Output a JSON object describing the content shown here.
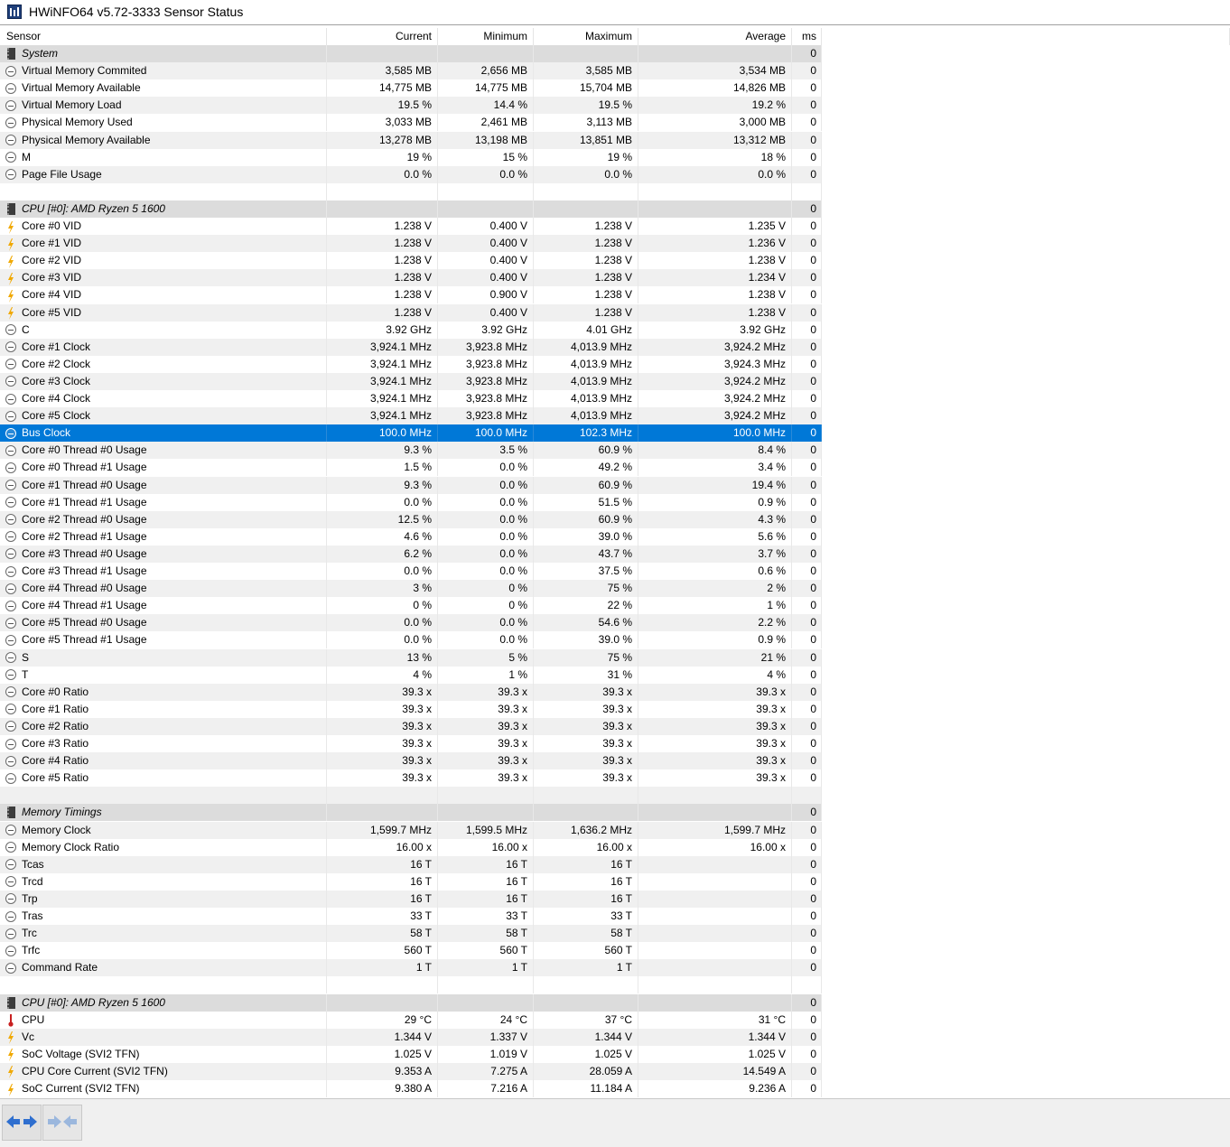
{
  "window": {
    "title": "HWiNFO64 v5.72-3333 Sensor Status"
  },
  "columns": {
    "sensor": "Sensor",
    "current": "Current",
    "minimum": "Minimum",
    "maximum": "Maximum",
    "average": "Average",
    "ms": "ms"
  },
  "rows": [
    {
      "type": "group",
      "icon": "chip-icon",
      "name": "System",
      "ms": "0"
    },
    {
      "type": "item",
      "icon": "gauge-icon",
      "name": "Virtual Memory Commited",
      "cur": "3,585 MB",
      "min": "2,656 MB",
      "max": "3,585 MB",
      "avg": "3,534 MB",
      "ms": "0"
    },
    {
      "type": "item",
      "icon": "gauge-icon",
      "name": "Virtual Memory Available",
      "cur": "14,775 MB",
      "min": "14,775 MB",
      "max": "15,704 MB",
      "avg": "14,826 MB",
      "ms": "0"
    },
    {
      "type": "item",
      "icon": "gauge-icon",
      "name": "Virtual Memory Load",
      "cur": "19.5 %",
      "min": "14.4 %",
      "max": "19.5 %",
      "avg": "19.2 %",
      "ms": "0"
    },
    {
      "type": "item",
      "icon": "gauge-icon",
      "name": "Physical Memory Used",
      "cur": "3,033 MB",
      "min": "2,461 MB",
      "max": "3,113 MB",
      "avg": "3,000 MB",
      "ms": "0"
    },
    {
      "type": "item",
      "icon": "gauge-icon",
      "name": "Physical Memory Available",
      "cur": "13,278 MB",
      "min": "13,198 MB",
      "max": "13,851 MB",
      "avg": "13,312 MB",
      "ms": "0"
    },
    {
      "type": "item",
      "icon": "gauge-icon",
      "name": "M",
      "cur": "19 %",
      "min": "15 %",
      "max": "19 %",
      "avg": "18 %",
      "ms": "0"
    },
    {
      "type": "item",
      "icon": "gauge-icon",
      "name": "Page File Usage",
      "cur": "0.0 %",
      "min": "0.0 %",
      "max": "0.0 %",
      "avg": "0.0 %",
      "ms": "0"
    },
    {
      "type": "blank"
    },
    {
      "type": "group",
      "icon": "chip-icon",
      "name": "CPU [#0]: AMD Ryzen 5 1600",
      "ms": "0"
    },
    {
      "type": "item",
      "icon": "voltage-icon",
      "name": "Core #0 VID",
      "cur": "1.238 V",
      "min": "0.400 V",
      "max": "1.238 V",
      "avg": "1.235 V",
      "ms": "0"
    },
    {
      "type": "item",
      "icon": "voltage-icon",
      "name": "Core #1 VID",
      "cur": "1.238 V",
      "min": "0.400 V",
      "max": "1.238 V",
      "avg": "1.236 V",
      "ms": "0"
    },
    {
      "type": "item",
      "icon": "voltage-icon",
      "name": "Core #2 VID",
      "cur": "1.238 V",
      "min": "0.400 V",
      "max": "1.238 V",
      "avg": "1.238 V",
      "ms": "0"
    },
    {
      "type": "item",
      "icon": "voltage-icon",
      "name": "Core #3 VID",
      "cur": "1.238 V",
      "min": "0.400 V",
      "max": "1.238 V",
      "avg": "1.234 V",
      "ms": "0"
    },
    {
      "type": "item",
      "icon": "voltage-icon",
      "name": "Core #4 VID",
      "cur": "1.238 V",
      "min": "0.900 V",
      "max": "1.238 V",
      "avg": "1.238 V",
      "ms": "0"
    },
    {
      "type": "item",
      "icon": "voltage-icon",
      "name": "Core #5 VID",
      "cur": "1.238 V",
      "min": "0.400 V",
      "max": "1.238 V",
      "avg": "1.238 V",
      "ms": "0"
    },
    {
      "type": "item",
      "icon": "gauge-icon",
      "name": "C",
      "cur": "3.92 GHz",
      "min": "3.92 GHz",
      "max": "4.01 GHz",
      "avg": "3.92 GHz",
      "ms": "0"
    },
    {
      "type": "item",
      "icon": "gauge-icon",
      "name": "Core #1 Clock",
      "cur": "3,924.1 MHz",
      "min": "3,923.8 MHz",
      "max": "4,013.9 MHz",
      "avg": "3,924.2 MHz",
      "ms": "0"
    },
    {
      "type": "item",
      "icon": "gauge-icon",
      "name": "Core #2 Clock",
      "cur": "3,924.1 MHz",
      "min": "3,923.8 MHz",
      "max": "4,013.9 MHz",
      "avg": "3,924.3 MHz",
      "ms": "0"
    },
    {
      "type": "item",
      "icon": "gauge-icon",
      "name": "Core #3 Clock",
      "cur": "3,924.1 MHz",
      "min": "3,923.8 MHz",
      "max": "4,013.9 MHz",
      "avg": "3,924.2 MHz",
      "ms": "0"
    },
    {
      "type": "item",
      "icon": "gauge-icon",
      "name": "Core #4 Clock",
      "cur": "3,924.1 MHz",
      "min": "3,923.8 MHz",
      "max": "4,013.9 MHz",
      "avg": "3,924.2 MHz",
      "ms": "0"
    },
    {
      "type": "item",
      "icon": "gauge-icon",
      "name": "Core #5 Clock",
      "cur": "3,924.1 MHz",
      "min": "3,923.8 MHz",
      "max": "4,013.9 MHz",
      "avg": "3,924.2 MHz",
      "ms": "0"
    },
    {
      "type": "item",
      "icon": "gauge-icon",
      "name": "Bus Clock",
      "cur": "100.0 MHz",
      "min": "100.0 MHz",
      "max": "102.3 MHz",
      "avg": "100.0 MHz",
      "ms": "0",
      "selected": true
    },
    {
      "type": "item",
      "icon": "gauge-icon",
      "name": "Core #0 Thread #0 Usage",
      "cur": "9.3 %",
      "min": "3.5 %",
      "max": "60.9 %",
      "avg": "8.4 %",
      "ms": "0"
    },
    {
      "type": "item",
      "icon": "gauge-icon",
      "name": "Core #0 Thread #1 Usage",
      "cur": "1.5 %",
      "min": "0.0 %",
      "max": "49.2 %",
      "avg": "3.4 %",
      "ms": "0"
    },
    {
      "type": "item",
      "icon": "gauge-icon",
      "name": "Core #1 Thread #0 Usage",
      "cur": "9.3 %",
      "min": "0.0 %",
      "max": "60.9 %",
      "avg": "19.4 %",
      "ms": "0"
    },
    {
      "type": "item",
      "icon": "gauge-icon",
      "name": "Core #1 Thread #1 Usage",
      "cur": "0.0 %",
      "min": "0.0 %",
      "max": "51.5 %",
      "avg": "0.9 %",
      "ms": "0"
    },
    {
      "type": "item",
      "icon": "gauge-icon",
      "name": "Core #2 Thread #0 Usage",
      "cur": "12.5 %",
      "min": "0.0 %",
      "max": "60.9 %",
      "avg": "4.3 %",
      "ms": "0"
    },
    {
      "type": "item",
      "icon": "gauge-icon",
      "name": "Core #2 Thread #1 Usage",
      "cur": "4.6 %",
      "min": "0.0 %",
      "max": "39.0 %",
      "avg": "5.6 %",
      "ms": "0"
    },
    {
      "type": "item",
      "icon": "gauge-icon",
      "name": "Core #3 Thread #0 Usage",
      "cur": "6.2 %",
      "min": "0.0 %",
      "max": "43.7 %",
      "avg": "3.7 %",
      "ms": "0"
    },
    {
      "type": "item",
      "icon": "gauge-icon",
      "name": "Core #3 Thread #1 Usage",
      "cur": "0.0 %",
      "min": "0.0 %",
      "max": "37.5 %",
      "avg": "0.6 %",
      "ms": "0"
    },
    {
      "type": "item",
      "icon": "gauge-icon",
      "name": "Core #4 Thread #0 Usage",
      "cur": "3 %",
      "min": "0 %",
      "max": "75 %",
      "avg": "2 %",
      "ms": "0"
    },
    {
      "type": "item",
      "icon": "gauge-icon",
      "name": "Core #4 Thread #1 Usage",
      "cur": "0 %",
      "min": "0 %",
      "max": "22 %",
      "avg": "1 %",
      "ms": "0"
    },
    {
      "type": "item",
      "icon": "gauge-icon",
      "name": "Core #5 Thread #0 Usage",
      "cur": "0.0 %",
      "min": "0.0 %",
      "max": "54.6 %",
      "avg": "2.2 %",
      "ms": "0"
    },
    {
      "type": "item",
      "icon": "gauge-icon",
      "name": "Core #5 Thread #1 Usage",
      "cur": "0.0 %",
      "min": "0.0 %",
      "max": "39.0 %",
      "avg": "0.9 %",
      "ms": "0"
    },
    {
      "type": "item",
      "icon": "gauge-icon",
      "name": "S",
      "cur": "13 %",
      "min": "5 %",
      "max": "75 %",
      "avg": "21 %",
      "ms": "0"
    },
    {
      "type": "item",
      "icon": "gauge-icon",
      "name": "T",
      "cur": "4 %",
      "min": "1 %",
      "max": "31 %",
      "avg": "4 %",
      "ms": "0"
    },
    {
      "type": "item",
      "icon": "gauge-icon",
      "name": "Core #0 Ratio",
      "cur": "39.3 x",
      "min": "39.3 x",
      "max": "39.3 x",
      "avg": "39.3 x",
      "ms": "0"
    },
    {
      "type": "item",
      "icon": "gauge-icon",
      "name": "Core #1 Ratio",
      "cur": "39.3 x",
      "min": "39.3 x",
      "max": "39.3 x",
      "avg": "39.3 x",
      "ms": "0"
    },
    {
      "type": "item",
      "icon": "gauge-icon",
      "name": "Core #2 Ratio",
      "cur": "39.3 x",
      "min": "39.3 x",
      "max": "39.3 x",
      "avg": "39.3 x",
      "ms": "0"
    },
    {
      "type": "item",
      "icon": "gauge-icon",
      "name": "Core #3 Ratio",
      "cur": "39.3 x",
      "min": "39.3 x",
      "max": "39.3 x",
      "avg": "39.3 x",
      "ms": "0"
    },
    {
      "type": "item",
      "icon": "gauge-icon",
      "name": "Core #4 Ratio",
      "cur": "39.3 x",
      "min": "39.3 x",
      "max": "39.3 x",
      "avg": "39.3 x",
      "ms": "0"
    },
    {
      "type": "item",
      "icon": "gauge-icon",
      "name": "Core #5 Ratio",
      "cur": "39.3 x",
      "min": "39.3 x",
      "max": "39.3 x",
      "avg": "39.3 x",
      "ms": "0"
    },
    {
      "type": "blank"
    },
    {
      "type": "group",
      "icon": "chip-icon",
      "name": "Memory Timings",
      "ms": "0"
    },
    {
      "type": "item",
      "icon": "gauge-icon",
      "name": "Memory Clock",
      "cur": "1,599.7 MHz",
      "min": "1,599.5 MHz",
      "max": "1,636.2 MHz",
      "avg": "1,599.7 MHz",
      "ms": "0"
    },
    {
      "type": "item",
      "icon": "gauge-icon",
      "name": "Memory Clock Ratio",
      "cur": "16.00 x",
      "min": "16.00 x",
      "max": "16.00 x",
      "avg": "16.00 x",
      "ms": "0"
    },
    {
      "type": "item",
      "icon": "gauge-icon",
      "name": "Tcas",
      "cur": "16 T",
      "min": "16 T",
      "max": "16 T",
      "avg": "",
      "ms": "0"
    },
    {
      "type": "item",
      "icon": "gauge-icon",
      "name": "Trcd",
      "cur": "16 T",
      "min": "16 T",
      "max": "16 T",
      "avg": "",
      "ms": "0"
    },
    {
      "type": "item",
      "icon": "gauge-icon",
      "name": "Trp",
      "cur": "16 T",
      "min": "16 T",
      "max": "16 T",
      "avg": "",
      "ms": "0"
    },
    {
      "type": "item",
      "icon": "gauge-icon",
      "name": "Tras",
      "cur": "33 T",
      "min": "33 T",
      "max": "33 T",
      "avg": "",
      "ms": "0"
    },
    {
      "type": "item",
      "icon": "gauge-icon",
      "name": "Trc",
      "cur": "58 T",
      "min": "58 T",
      "max": "58 T",
      "avg": "",
      "ms": "0"
    },
    {
      "type": "item",
      "icon": "gauge-icon",
      "name": "Trfc",
      "cur": "560 T",
      "min": "560 T",
      "max": "560 T",
      "avg": "",
      "ms": "0"
    },
    {
      "type": "item",
      "icon": "gauge-icon",
      "name": "Command Rate",
      "cur": "1 T",
      "min": "1 T",
      "max": "1 T",
      "avg": "",
      "ms": "0"
    },
    {
      "type": "blank"
    },
    {
      "type": "group",
      "icon": "chip-icon",
      "name": "CPU [#0]: AMD Ryzen 5 1600",
      "ms": "0"
    },
    {
      "type": "item",
      "icon": "temperature-icon",
      "name": "CPU",
      "cur": "29 °C",
      "min": "24 °C",
      "max": "37 °C",
      "avg": "31 °C",
      "ms": "0"
    },
    {
      "type": "item",
      "icon": "voltage-icon",
      "name": "Vc",
      "cur": "1.344 V",
      "min": "1.337 V",
      "max": "1.344 V",
      "avg": "1.344 V",
      "ms": "0"
    },
    {
      "type": "item",
      "icon": "voltage-icon",
      "name": "SoC Voltage (SVI2 TFN)",
      "cur": "1.025 V",
      "min": "1.019 V",
      "max": "1.025 V",
      "avg": "1.025 V",
      "ms": "0"
    },
    {
      "type": "item",
      "icon": "voltage-icon",
      "name": "CPU Core Current (SVI2 TFN)",
      "cur": "9.353 A",
      "min": "7.275 A",
      "max": "28.059 A",
      "avg": "14.549 A",
      "ms": "0"
    },
    {
      "type": "item",
      "icon": "voltage-icon",
      "name": "SoC Current (SVI2 TFN)",
      "cur": "9.380 A",
      "min": "7.216 A",
      "max": "11.184 A",
      "avg": "9.236 A",
      "ms": "0"
    }
  ],
  "toolbar": {
    "left_icon": "arrows-expand-icon",
    "right_icon": "arrows-collapse-icon"
  },
  "colors": {
    "selection": "#0078d7",
    "group_bg": "#dcdcdc",
    "alt_row": "#f0f0f0",
    "bolt": "#f0a800"
  }
}
